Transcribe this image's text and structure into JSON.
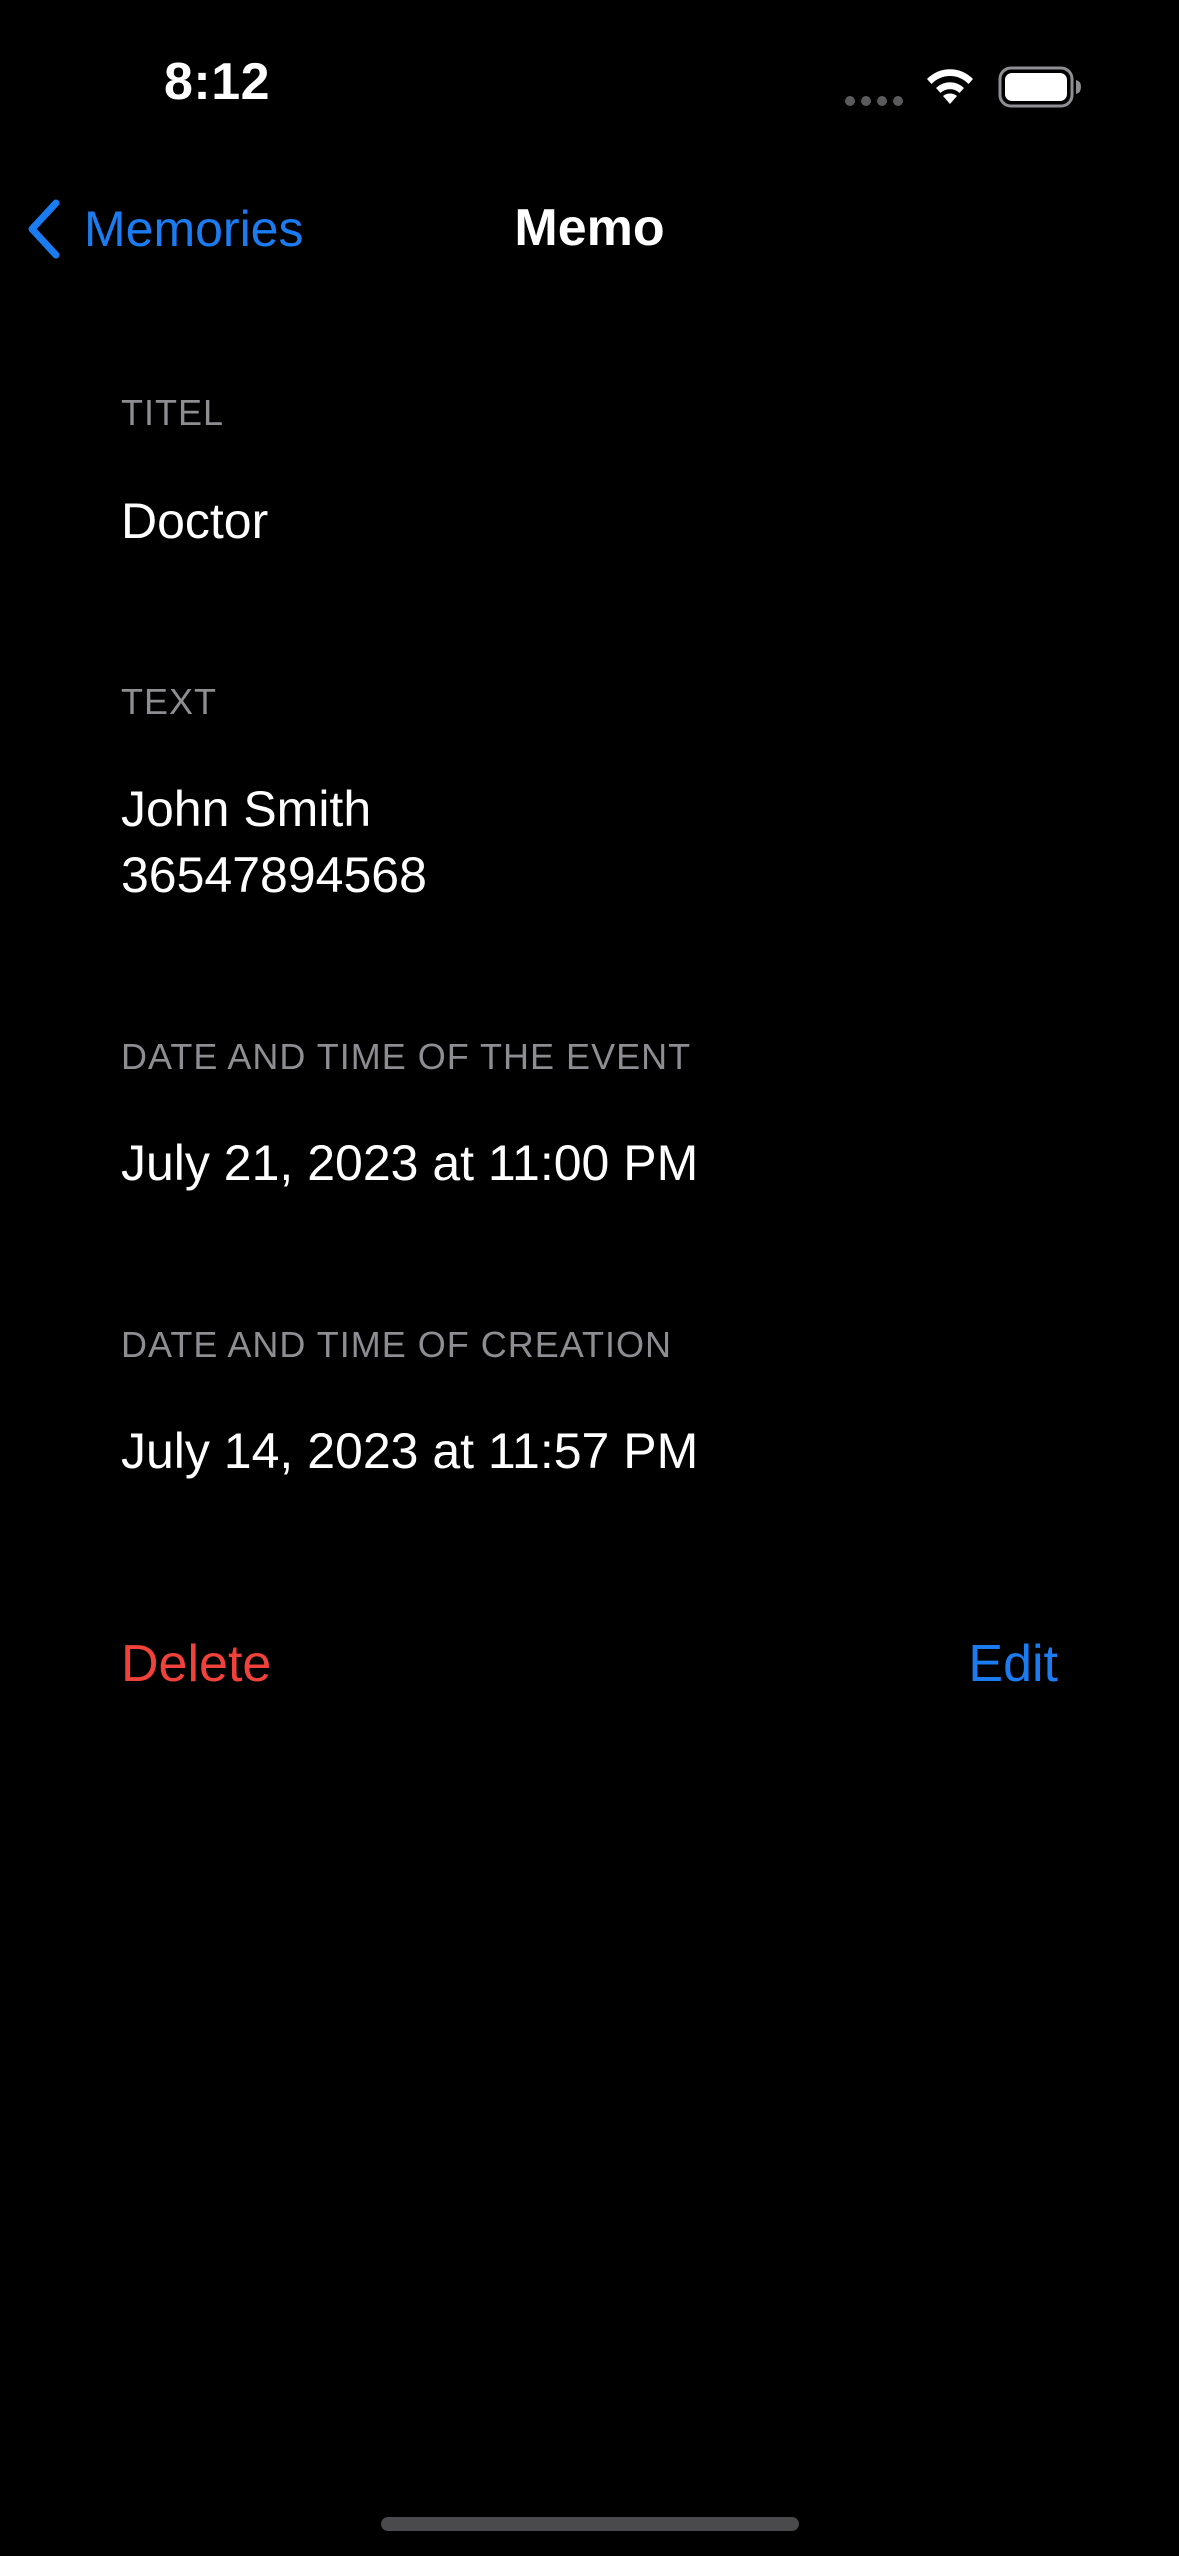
{
  "status_bar": {
    "time": "8:12"
  },
  "nav": {
    "back_label": "Memories",
    "title": "Memo"
  },
  "fields": {
    "title_label": "TITEL",
    "title_value": "Doctor",
    "text_label": "TEXT",
    "text_line1": "John Smith",
    "text_line2": "36547894568",
    "event_label": "DATE AND TIME OF THE EVENT",
    "event_value": "July 21, 2023 at 11:00 PM",
    "creation_label": "DATE AND TIME OF CREATION",
    "creation_value": "July 14, 2023 at 11:57 PM"
  },
  "actions": {
    "delete_label": "Delete",
    "edit_label": "Edit"
  },
  "icons": {
    "back": "chevron-left-icon",
    "wifi": "wifi-icon",
    "battery": "battery-icon",
    "signal": "cellular-signal-icon"
  },
  "colors": {
    "accent": "#1b7cf2",
    "destructive": "#f0413a",
    "background": "#000000",
    "secondary_text": "#8d8d92"
  }
}
